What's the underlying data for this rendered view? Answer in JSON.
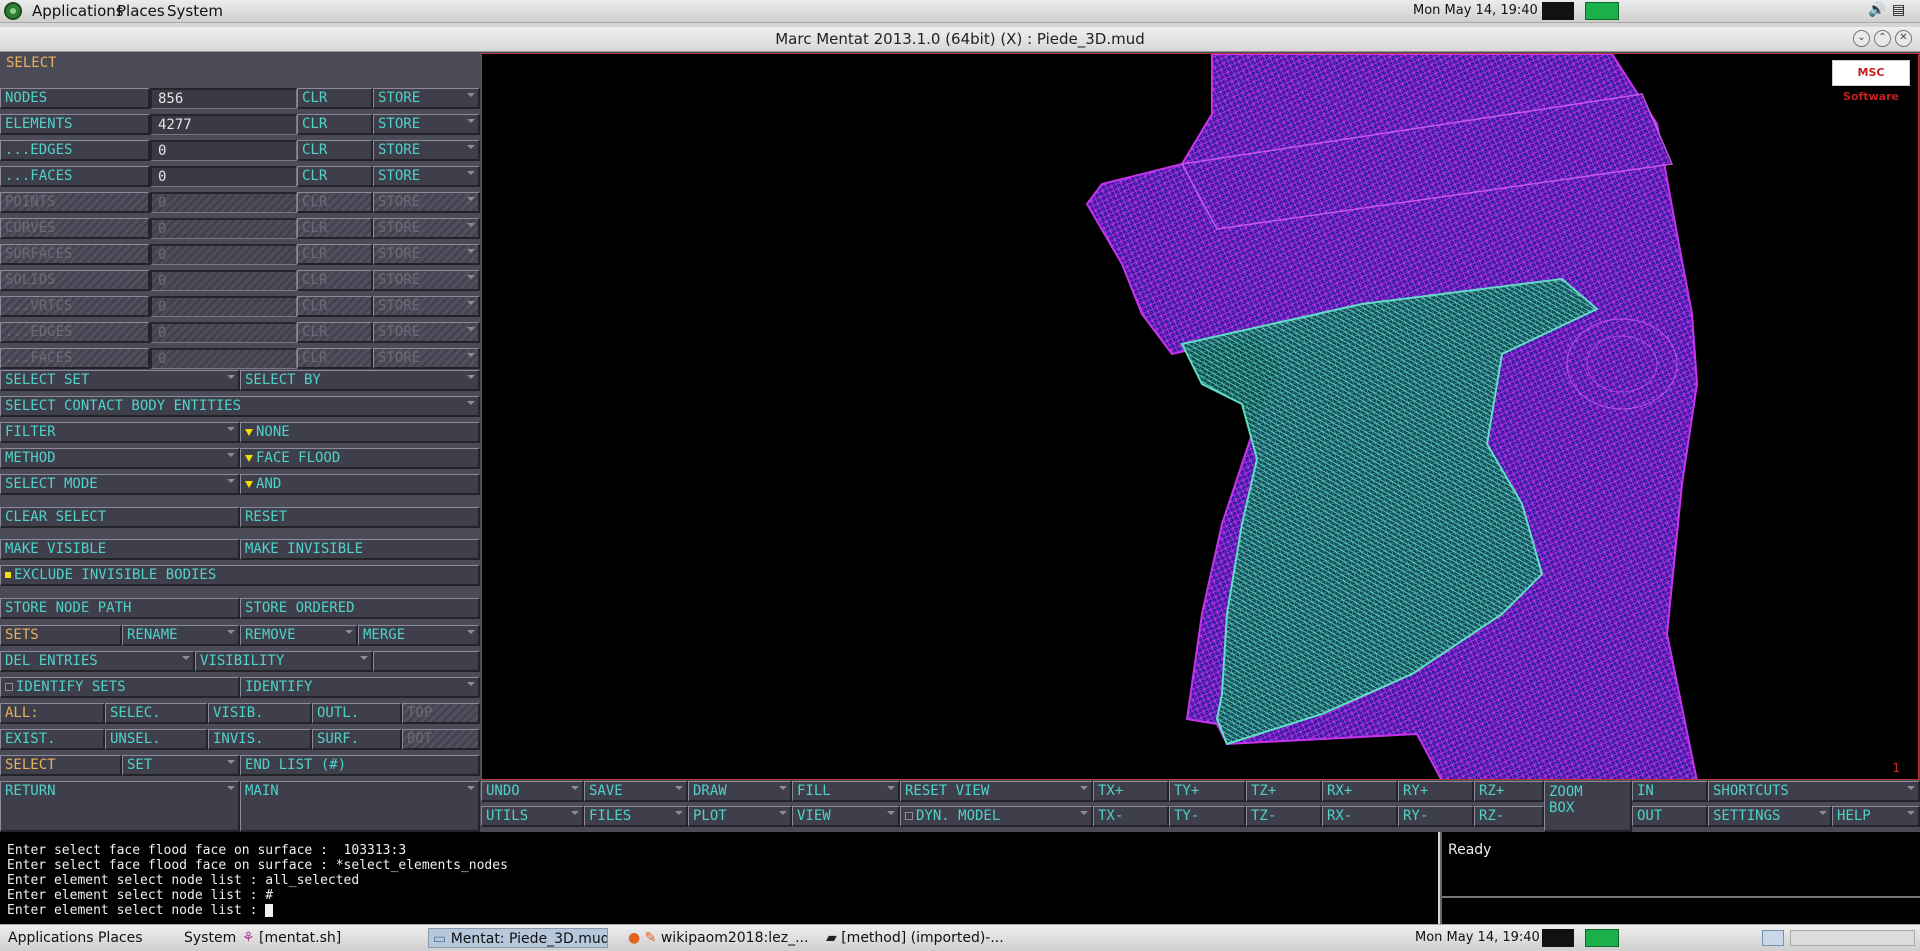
{
  "topbar": {
    "menus": [
      "Applications",
      "Places",
      "System"
    ],
    "clock": "Mon May 14, 19:40"
  },
  "window": {
    "title": "Marc Mentat 2013.1.0 (64bit) (X) : Piede_3D.mud"
  },
  "panel": {
    "header": "SELECT",
    "rows": [
      {
        "label": "NODES",
        "value": "856",
        "clr": "CLR",
        "store": "STORE",
        "enabled": true
      },
      {
        "label": "ELEMENTS",
        "value": "4277",
        "clr": "CLR",
        "store": "STORE",
        "enabled": true
      },
      {
        "label": "...EDGES",
        "value": "0",
        "clr": "CLR",
        "store": "STORE",
        "enabled": true
      },
      {
        "label": "...FACES",
        "value": "0",
        "clr": "CLR",
        "store": "STORE",
        "enabled": true
      },
      {
        "label": "POINTS",
        "value": "0",
        "clr": "CLR",
        "store": "STORE",
        "enabled": false
      },
      {
        "label": "CURVES",
        "value": "0",
        "clr": "CLR",
        "store": "STORE",
        "enabled": false
      },
      {
        "label": "SURFACES",
        "value": "0",
        "clr": "CLR",
        "store": "STORE",
        "enabled": false
      },
      {
        "label": "SOLIDS",
        "value": "0",
        "clr": "CLR",
        "store": "STORE",
        "enabled": false
      },
      {
        "label": "...VRTCS",
        "value": "0",
        "clr": "CLR",
        "store": "STORE",
        "enabled": false
      },
      {
        "label": "...EDGES",
        "value": "0",
        "clr": "CLR",
        "store": "STORE",
        "enabled": false
      },
      {
        "label": "...FACES",
        "value": "0",
        "clr": "CLR",
        "store": "STORE",
        "enabled": false
      }
    ],
    "select_set": "SELECT SET",
    "select_by": "SELECT BY",
    "select_contact": "SELECT CONTACT BODY ENTITIES",
    "filter": "FILTER",
    "filter_value": "NONE",
    "method": "METHOD",
    "method_value": "FACE FLOOD",
    "select_mode": "SELECT MODE",
    "select_mode_value": "AND",
    "clear_select": "CLEAR SELECT",
    "reset": "RESET",
    "make_visible": "MAKE VISIBLE",
    "make_invisible": "MAKE INVISIBLE",
    "exclude_invisible": "EXCLUDE INVISIBLE BODIES",
    "store_node_path": "STORE NODE PATH",
    "store_ordered": "STORE ORDERED",
    "sets": "SETS",
    "rename": "RENAME",
    "remove": "REMOVE",
    "merge": "MERGE",
    "del_entries": "DEL ENTRIES",
    "visibility": "VISIBILITY",
    "identify_sets": "IDENTIFY SETS",
    "identify": "IDENTIFY",
    "all": "ALL:",
    "selec": "SELEC.",
    "visib": "VISIB.",
    "outl": "OUTL.",
    "top": "TOP",
    "exist": "EXIST.",
    "unsel": "UNSEL.",
    "invis": "INVIS.",
    "surf": "SURF.",
    "bot": "BOT",
    "select": "SELECT",
    "set": "SET",
    "end_list": "END LIST (#)",
    "return": "RETURN",
    "main": "MAIN"
  },
  "toolbar": {
    "undo": "UNDO",
    "save": "SAVE",
    "draw": "DRAW",
    "fill": "FILL",
    "reset_view": "RESET VIEW",
    "utils": "UTILS",
    "files": "FILES",
    "plot": "PLOT",
    "view": "VIEW",
    "dyn_model": "DYN. MODEL",
    "txp": "TX+",
    "typ": "TY+",
    "tzp": "TZ+",
    "rxp": "RX+",
    "ryp": "RY+",
    "rzp": "RZ+",
    "txm": "TX-",
    "tym": "TY-",
    "tzm": "TZ-",
    "rxm": "RX-",
    "rym": "RY-",
    "rzm": "RZ-",
    "zoom_box_1": "ZOOM",
    "zoom_box_2": "BOX",
    "in": "IN",
    "out": "OUT",
    "shortcuts": "SHORTCUTS",
    "settings": "SETTINGS",
    "help": "HELP"
  },
  "viewport": {
    "logo_text": "MSC Software",
    "page_number": "1",
    "mesh_colors": {
      "outer": "#c02ee6",
      "outer_fill": "#2a14a0",
      "inner": "#5fe0c6"
    }
  },
  "console": {
    "lines": [
      "Enter select face flood face on surface :  103313:3",
      "Enter select face flood face on surface : *select_elements_nodes",
      "Enter element select node list : all_selected",
      "Enter element select node list : #",
      "Enter element select node list : "
    ]
  },
  "status": {
    "text": "Ready"
  },
  "taskbar": {
    "tasks": [
      "[mentat.sh]",
      "Mentat: Piede_3D.mud",
      "wikipaom2018:lez_...",
      "[method] (imported)-..."
    ],
    "clock": "Mon May 14, 19:40"
  }
}
